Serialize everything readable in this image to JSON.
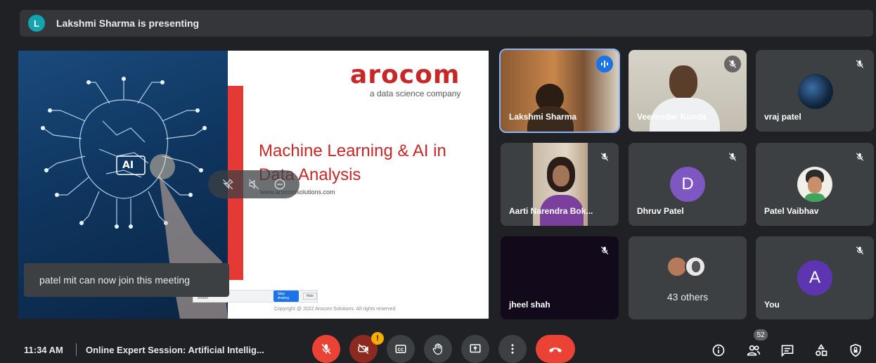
{
  "top_bar": {
    "presenter_initial": "L",
    "presenting_text": "Lakshmi Sharma is presenting"
  },
  "slide": {
    "logo": "arocom",
    "tagline": "a data science company",
    "title": "Machine Learning & AI in Data Analysis",
    "url": "www.arocomsolutions.com",
    "copyright": "Copyright @ 2022 Arocom Solutions. All rights reserved",
    "share_notice": "You are sharing your screen",
    "stop_sharing_label": "Stop sharing",
    "hide_label": "Hide",
    "brain_label": "AI"
  },
  "toast": {
    "message": "patel mit can now join this meeting"
  },
  "participants": [
    {
      "name": "Lakshmi Sharma",
      "state": "speaking"
    },
    {
      "name": "Veerendar Konda",
      "state": "muted"
    },
    {
      "name": "vraj patel",
      "state": "muted"
    },
    {
      "name": "Aarti Narendra Bok...",
      "state": "muted"
    },
    {
      "name": "Dhruv Patel",
      "initial": "D",
      "avatar_color": "#7e57c2",
      "state": "muted"
    },
    {
      "name": "Patel Vaibhav",
      "state": "muted"
    },
    {
      "name": "jheel shah",
      "state": "muted"
    },
    {
      "name": "43 others"
    },
    {
      "name": "You",
      "initial": "A",
      "avatar_color": "#5e35b1",
      "state": "muted"
    }
  ],
  "bottom_bar": {
    "time": "11:34 AM",
    "meeting_title": "Online Expert Session: Artificial Intellig...",
    "camera_warning": "!",
    "people_count": "52"
  },
  "colors": {
    "hangup": "#ea4335",
    "accent": "#1a73e8",
    "slide_red": "#c62828"
  }
}
